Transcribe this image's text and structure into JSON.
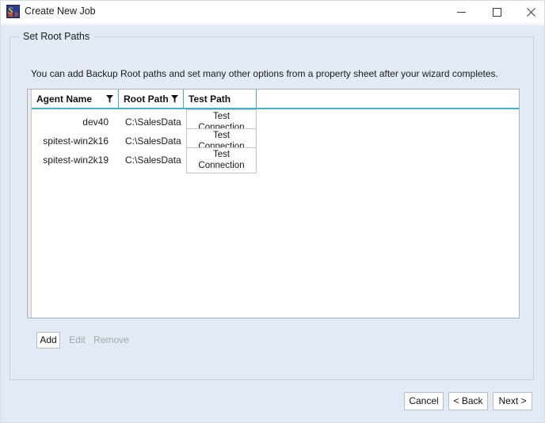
{
  "window": {
    "title": "Create New Job",
    "icon": "app-icon",
    "controls": {
      "minimize": "minimize-icon",
      "maximize": "maximize-icon",
      "close": "close-icon"
    }
  },
  "group": {
    "label": "Set Root Paths"
  },
  "instruction": "You can add Backup Root paths and set many other options from a property sheet after your wizard completes.",
  "grid": {
    "columns": [
      {
        "label": "Agent Name",
        "filter": true
      },
      {
        "label": "Root Path",
        "filter": true
      },
      {
        "label": "Test Path",
        "filter": false
      },
      {
        "label": "",
        "filter": false
      }
    ],
    "rows": [
      {
        "agent_name": "dev40",
        "root_path": "C:\\SalesData",
        "test_path_label": "Test Connection"
      },
      {
        "agent_name": "spitest-win2k16",
        "root_path": "C:\\SalesData",
        "test_path_label": "Test Connection"
      },
      {
        "agent_name": "spitest-win2k19",
        "root_path": "C:\\SalesData",
        "test_path_label": "Test Connection"
      }
    ]
  },
  "record_buttons": {
    "add": "Add",
    "edit": "Edit",
    "remove": "Remove"
  },
  "wizard_buttons": {
    "cancel": "Cancel",
    "back": "< Back",
    "next": "Next >"
  },
  "colors": {
    "window_background": "#e3eaf5",
    "titlebar_background": "#ffffff",
    "grid_accent": "#3fb4c4",
    "grid_background": "#ffffff",
    "disabled_text": "#a6a6a6"
  }
}
